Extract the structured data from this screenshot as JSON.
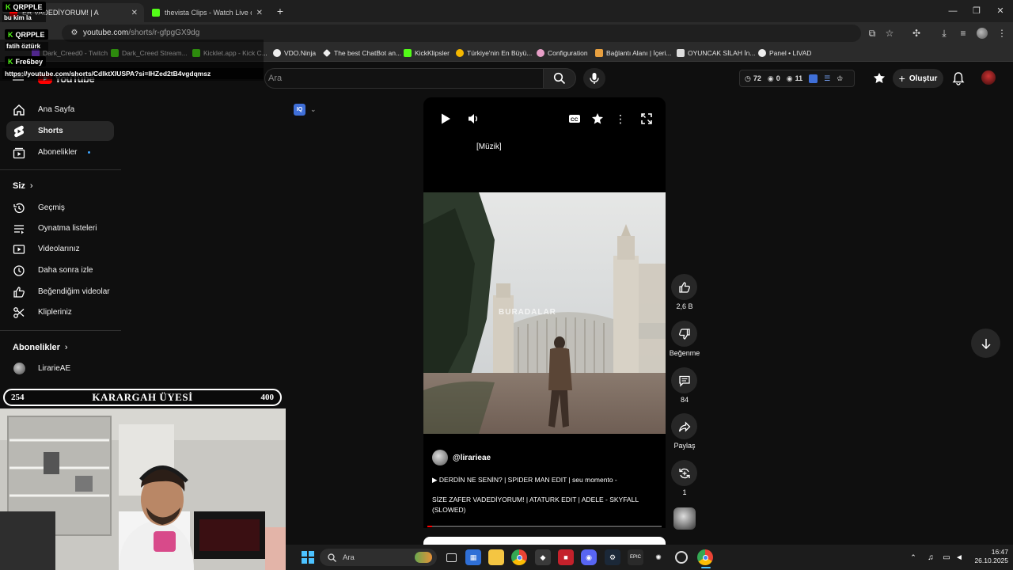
{
  "browser": {
    "tabs": [
      {
        "title": "ER VADEDİYORUM! | A",
        "active": true
      },
      {
        "title": "thevista Clips - Watch Live on Ki",
        "active": false
      }
    ],
    "url_host": "youtube.com",
    "url_path": "/shorts/r-gfpgGX9dg",
    "bookmarks": [
      {
        "label": "Dark_Creed0 - Twitch",
        "color": "#9146ff"
      },
      {
        "label": "Dark_Creed Stream...",
        "color": "#53fc18"
      },
      {
        "label": "Kicklet.app - Kick C...",
        "color": "#53fc18"
      },
      {
        "label": "VDO.Ninja",
        "color": "#ffffff"
      },
      {
        "label": "The best ChatBot an...",
        "color": "#ffffff"
      },
      {
        "label": "KickKlipsler",
        "color": "#53fc18"
      },
      {
        "label": "Türkiye'nin En Büyü...",
        "color": "#f5b800"
      },
      {
        "label": "Configuration",
        "color": "#e8a0c8"
      },
      {
        "label": "Bağlantı Alanı | İçeri...",
        "color": "#e8a040"
      },
      {
        "label": "OYUNCAK SİLAH İn...",
        "color": "#dddddd"
      },
      {
        "label": "Panel • LIVAD",
        "color": "#ffffff"
      }
    ]
  },
  "youtube": {
    "logo_text": "YouTube",
    "search_placeholder": "Ara",
    "stats": {
      "views": "72",
      "likes": "0",
      "comments": "11"
    },
    "create_label": "Oluştur",
    "sidebar": {
      "main": [
        {
          "label": "Ana Sayfa",
          "icon": "home-icon"
        },
        {
          "label": "Shorts",
          "icon": "shorts-icon",
          "active": true
        },
        {
          "label": "Abonelikler",
          "icon": "subscriptions-icon"
        }
      ],
      "you_heading": "Siz",
      "you": [
        {
          "label": "Geçmiş",
          "icon": "history-icon"
        },
        {
          "label": "Oynatma listeleri",
          "icon": "playlists-icon"
        },
        {
          "label": "Videolarınız",
          "icon": "your-videos-icon"
        },
        {
          "label": "Daha sonra izle",
          "icon": "watch-later-icon"
        },
        {
          "label": "Beğendiğim videolar",
          "icon": "liked-icon"
        },
        {
          "label": "Klipleriniz",
          "icon": "clips-icon"
        }
      ],
      "subs_heading": "Abonelikler",
      "subs": [
        {
          "label": "LirarieAE"
        }
      ]
    },
    "short": {
      "captions": "[Müzik]",
      "watermark": "BURADALAR",
      "channel": "@lirarieae",
      "title": "▶  DERDİN NE SENİN? | SPIDER MAN EDIT | seu momento -",
      "description": "SİZE ZAFER VADEDİYORUM! | ATATURK EDIT | ADELE - SKYFALL (SLOWED)",
      "progress": 0.02
    },
    "actions": {
      "likes": "2,6 B",
      "dislike": "Beğenme",
      "comments": "84",
      "share": "Paylaş",
      "remix": "1"
    }
  },
  "overlay": {
    "chat": [
      {
        "badge": "QRPPLE",
        "text": "bu kim la"
      },
      {
        "badge": "QRPPLE",
        "text": "fatih öztürk"
      },
      {
        "badge": "Fre6bey",
        "text": "https://youtube.com/shorts/CdlktXIUSPA?si=IHZed2tB4vgdqmsz"
      }
    ],
    "member_goal": {
      "current": "254",
      "label": "KARARGAH ÜYESİ",
      "target": "400"
    }
  },
  "taskbar": {
    "search_placeholder": "Ara",
    "time": "16:47",
    "date": "26.10.2025"
  }
}
